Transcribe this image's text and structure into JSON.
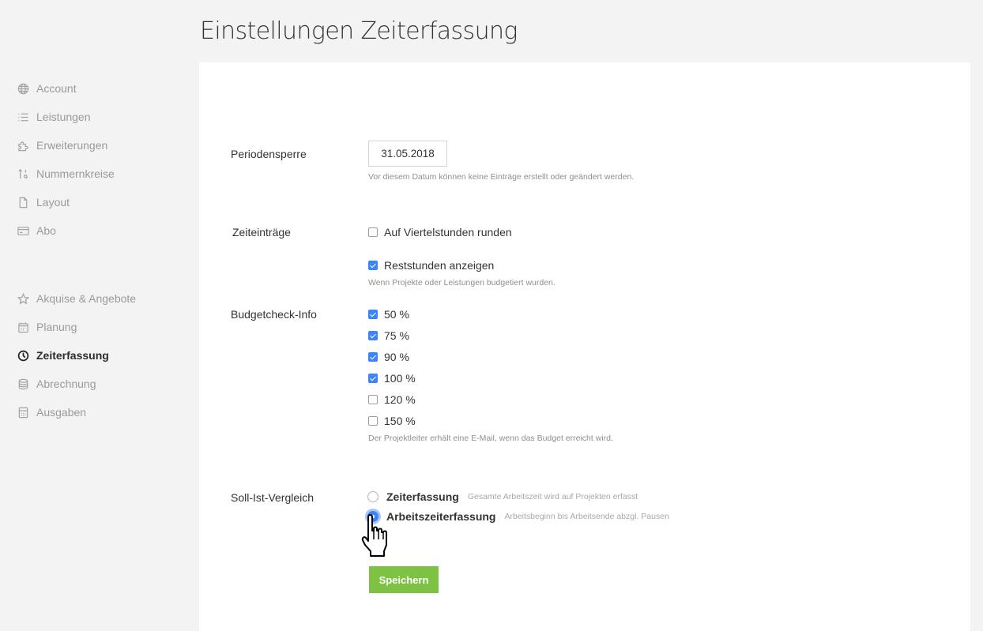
{
  "page": {
    "title": "Einstellungen Zeiterfassung"
  },
  "sidebar": {
    "group1": [
      {
        "label": "Account",
        "icon": "globe-icon"
      },
      {
        "label": "Leistungen",
        "icon": "list-icon"
      },
      {
        "label": "Erweiterungen",
        "icon": "puzzle-icon"
      },
      {
        "label": "Nummernkreise",
        "icon": "sort-numeric-icon"
      },
      {
        "label": "Layout",
        "icon": "file-icon"
      },
      {
        "label": "Abo",
        "icon": "credit-card-icon"
      }
    ],
    "group2": [
      {
        "label": "Akquise & Angebote",
        "icon": "star-icon"
      },
      {
        "label": "Planung",
        "icon": "calendar-icon"
      },
      {
        "label": "Zeiterfassung",
        "icon": "clock-icon",
        "active": true
      },
      {
        "label": "Abrechnung",
        "icon": "database-icon"
      },
      {
        "label": "Ausgaben",
        "icon": "calculator-icon"
      }
    ]
  },
  "form": {
    "periodensperre": {
      "label": "Periodensperre",
      "value": "31.05.2018",
      "hint": "Vor diesem Datum können keine Einträge erstellt oder geändert werden."
    },
    "zeiteintraege": {
      "label": "Zeiteinträge",
      "options": [
        {
          "label": "Auf Viertelstunden runden",
          "checked": false
        },
        {
          "label": "Reststunden anzeigen",
          "checked": true
        }
      ],
      "hint": "Wenn Projekte oder Leistungen budgetiert wurden."
    },
    "budgetcheck": {
      "label": "Budgetcheck-Info",
      "options": [
        {
          "label": "50 %",
          "checked": true
        },
        {
          "label": "75 %",
          "checked": true
        },
        {
          "label": "90 %",
          "checked": true
        },
        {
          "label": "100 %",
          "checked": true
        },
        {
          "label": "120 %",
          "checked": false
        },
        {
          "label": "150 %",
          "checked": false
        }
      ],
      "hint": "Der Projektleiter erhält eine E-Mail, wenn das Budget erreicht wird."
    },
    "soll_ist": {
      "label": "Soll-Ist-Vergleich",
      "options": [
        {
          "label": "Zeiterfassung",
          "desc": "Gesamte Arbeitszeit wird auf Projekten erfasst",
          "selected": false
        },
        {
          "label": "Arbeitszeiterfassung",
          "desc": "Arbeitsbeginn bis Arbeitsende abzgl. Pausen",
          "selected": true
        }
      ]
    },
    "save_label": "Speichern"
  },
  "colors": {
    "accent": "#3d84f6",
    "save": "#7dc242"
  }
}
